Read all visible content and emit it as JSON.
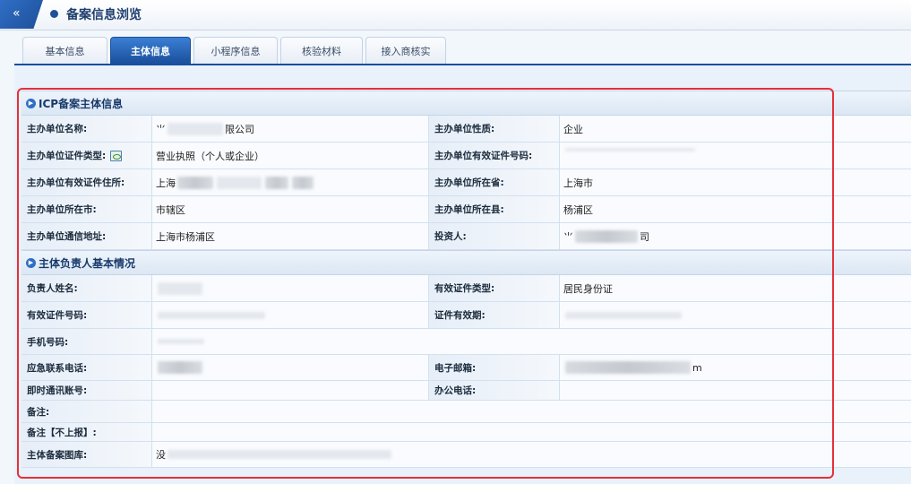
{
  "header": {
    "collapse_label": "«",
    "title": "备案信息浏览"
  },
  "tabs": [
    {
      "label": "基本信息",
      "active": false
    },
    {
      "label": "主体信息",
      "active": true
    },
    {
      "label": "小程序信息",
      "active": false
    },
    {
      "label": "核验材料",
      "active": false
    },
    {
      "label": "接入商核实",
      "active": false
    }
  ],
  "icp_section": {
    "title": "ICP备案主体信息",
    "rows": [
      {
        "l1": "主办单位名称:",
        "v1_prefix": "⺌",
        "v1_suffix": "限公司",
        "l2": "主办单位性质:",
        "v2": "企业"
      },
      {
        "l1": "主办单位证件类型:",
        "v1": "营业执照（个人或企业）",
        "l2": "主办单位有效证件号码:",
        "v2": ""
      },
      {
        "l1": "主办单位有效证件住所:",
        "v1_prefix": "上海",
        "l2": "主办单位所在省:",
        "v2": "上海市"
      },
      {
        "l1": "主办单位所在市:",
        "v1": "市辖区",
        "l2": "主办单位所在县:",
        "v2": "杨浦区"
      },
      {
        "l1": "主办单位通信地址:",
        "v1": "上海市杨浦区",
        "l2": "投资人:",
        "v2_prefix": "⺌",
        "v2_suffix": "司"
      }
    ]
  },
  "owner_section": {
    "title": "主体负责人基本情况",
    "rows": [
      {
        "l1": "负责人姓名:",
        "v1": "",
        "l2": "有效证件类型:",
        "v2": "居民身份证"
      },
      {
        "l1": "有效证件号码:",
        "v1": "",
        "l2": "证件有效期:",
        "v2": ""
      },
      {
        "l1": "手机号码:",
        "v1": ""
      },
      {
        "l1": "应急联系电话:",
        "v1": "",
        "l2": "电子邮箱:",
        "v2_suffix": "m"
      },
      {
        "l1": "即时通讯账号:",
        "v1": "",
        "l2": "办公电话:",
        "v2": ""
      },
      {
        "l1": "备注:",
        "v1": ""
      },
      {
        "l1": "备注【不上报】:",
        "v1": ""
      },
      {
        "l1": "主体备案图库:",
        "v1_prefix": "没"
      }
    ]
  },
  "colors": {
    "accent": "#1a4f9c",
    "highlight": "#e5303a"
  }
}
